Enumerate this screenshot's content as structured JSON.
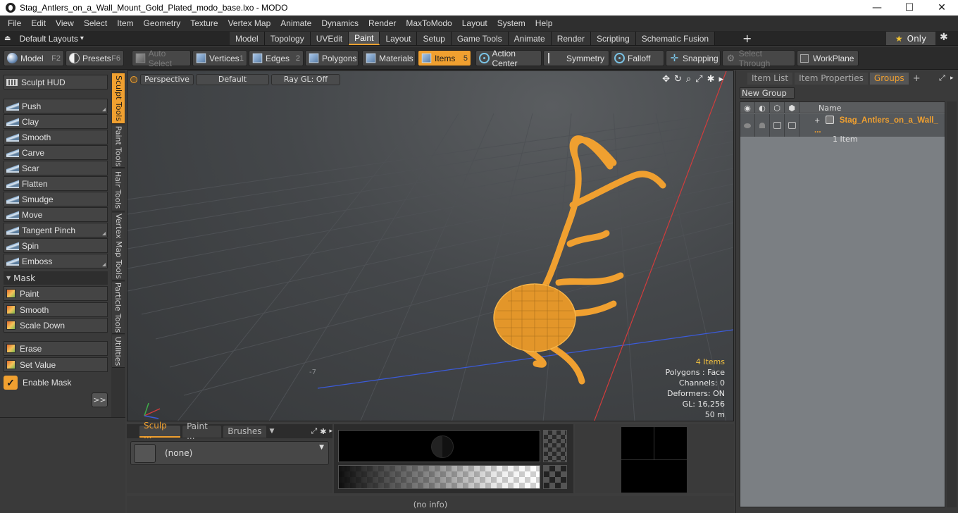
{
  "window": {
    "title": "Stag_Antlers_on_a_Wall_Mount_Gold_Plated_modo_base.lxo - MODO",
    "minimize": "—",
    "maximize": "☐",
    "close": "✕"
  },
  "menubar": [
    "File",
    "Edit",
    "View",
    "Select",
    "Item",
    "Geometry",
    "Texture",
    "Vertex Map",
    "Animate",
    "Dynamics",
    "Render",
    "MaxToModo",
    "Layout",
    "System",
    "Help"
  ],
  "layoutbar": {
    "layouts_label": "Default Layouts",
    "layouts_caret": "▾",
    "layouts_icon": "⏏",
    "tabs": [
      "Model",
      "Topology",
      "UVEdit",
      "Paint",
      "Layout",
      "Setup",
      "Game Tools",
      "Animate",
      "Render",
      "Scripting",
      "Schematic Fusion"
    ],
    "active_tab": "Paint",
    "plus": "+",
    "only_label": "Only",
    "only_star": "★",
    "gear": "✱"
  },
  "modebar": {
    "model_label": "Model",
    "model_key": "F2",
    "presets_label": "Presets",
    "presets_key": "F6",
    "auto_select": "Auto Select",
    "vertices": "Vertices",
    "vertices_key": "1",
    "edges": "Edges",
    "edges_key": "2",
    "polygons": "Polygons",
    "materials": "Materials",
    "items": "Items",
    "items_key": "5",
    "action_center": "Action Center",
    "symmetry": "Symmetry",
    "falloff": "Falloff",
    "snapping": "Snapping",
    "select_through": "Select Through",
    "workplane": "WorkPlane"
  },
  "sculpt_panel": {
    "hud": "Sculpt HUD",
    "tools": [
      "Push",
      "Clay",
      "Smooth",
      "Carve",
      "Scar",
      "Flatten",
      "Smudge",
      "Move",
      "Tangent Pinch",
      "Spin",
      "Emboss"
    ],
    "mask_header": "Mask",
    "mask_tools": [
      "Paint",
      "Smooth",
      "Scale Down"
    ],
    "value_tools": [
      "Erase",
      "Set Value"
    ],
    "enable_mask": "Enable Mask",
    "enable_mask_checked": true,
    "expand": ">>"
  },
  "vertical_tabs": [
    "Sculpt Tools",
    "Paint Tools",
    "Hair Tools",
    "Vertex Map Tools",
    "Particle Tools",
    "Utilities"
  ],
  "viewport": {
    "view": "Perspective",
    "shading": "Default",
    "raygl": "Ray GL: Off",
    "icons": [
      "move-icon",
      "rotate-icon",
      "zoom-icon",
      "maximize-icon",
      "gear-icon",
      "arrow-icon"
    ],
    "stats": {
      "items": "4 Items",
      "polygons": "Polygons : Face",
      "channels": "Channels: 0",
      "deformers": "Deformers: ON",
      "gl": "GL: 16,256",
      "distance": "50 m"
    },
    "grid_label": "-7",
    "model_color": "#f0a030",
    "axis_x": "#3b5bdb",
    "axis_z": "#d23c3c"
  },
  "bottom_left": {
    "tabs": [
      "Sculp ...",
      "Paint ...",
      "Brushes"
    ],
    "active_tab": "Sculp ...",
    "preset": "(none)"
  },
  "status": "(no info)",
  "right_panel": {
    "tabs": [
      "Item List",
      "Item Properties",
      "Groups"
    ],
    "active_tab": "Groups",
    "plus": "+",
    "new_group": "New Group",
    "name_header": "Name",
    "group_name": "Stag_Antlers_on_a_Wall_ ...",
    "group_count": "1 Item",
    "expand": "+"
  }
}
